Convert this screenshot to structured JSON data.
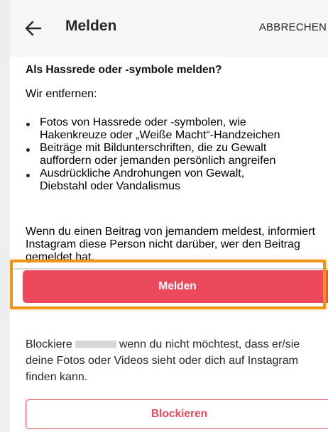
{
  "header": {
    "back_icon": "arrow-left-icon",
    "title": "Melden",
    "cancel_label": "ABBRECHEN"
  },
  "content": {
    "heading": "Als Hassrede oder -symbole melden?",
    "intro": "Wir entfernen:",
    "bullets": [
      {
        "line1": "Fotos von Hassrede oder -symbolen, wie",
        "line2": "Hakenkreuze oder „Weiße Macht“-Handzeichen"
      },
      {
        "line1": "Beiträge mit Bildunterschriften, die zu Gewalt",
        "line2": "auffordern oder jemanden persönlich angreifen"
      },
      {
        "line1": "Ausdrückliche Androhungen von Gewalt,",
        "line2": "Diebstahl oder Vandalismus"
      }
    ],
    "notice": "Wenn du einen Beitrag von jemandem meldest, informiert Instagram diese Person nicht darüber, wer den Beitrag gemeldet hat."
  },
  "actions": {
    "report_label": "Melden",
    "block_text_before": "Blockiere",
    "block_text_after": "wenn du nicht möchtest, dass er/sie deine Fotos oder Videos sieht oder dich auf Instagram finden kann.",
    "block_label": "Blockieren"
  },
  "colors": {
    "accent": "#ec4a5c",
    "highlight": "#f09418",
    "text": "#262626",
    "header_bg": "#f6f6f6"
  }
}
